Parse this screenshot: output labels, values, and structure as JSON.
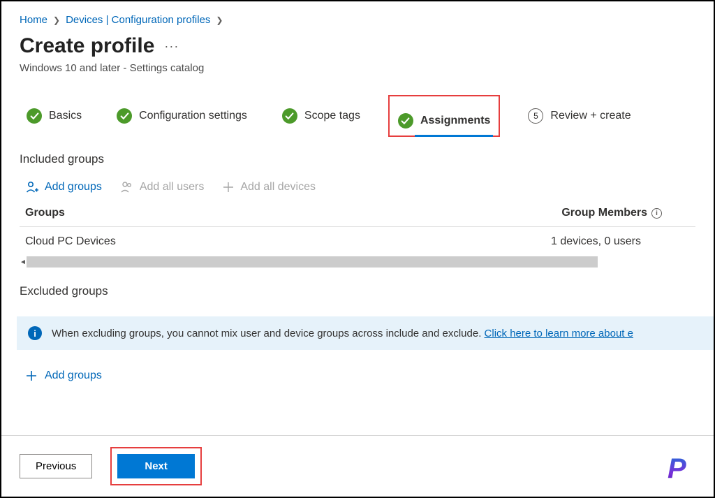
{
  "breadcrumb": {
    "home": "Home",
    "devices": "Devices | Configuration profiles"
  },
  "header": {
    "title": "Create profile",
    "subtitle": "Windows 10 and later - Settings catalog"
  },
  "steps": {
    "basics": "Basics",
    "config": "Configuration settings",
    "scope": "Scope tags",
    "assignments": "Assignments",
    "review_num": "5",
    "review": "Review + create"
  },
  "included": {
    "section": "Included groups",
    "add_groups": "Add groups",
    "add_all_users": "Add all users",
    "add_all_devices": "Add all devices",
    "col_groups": "Groups",
    "col_members": "Group Members",
    "row_name": "Cloud PC Devices",
    "row_members": "1 devices, 0 users"
  },
  "excluded": {
    "section": "Excluded groups",
    "banner_text": "When excluding groups, you cannot mix user and device groups across include and exclude. ",
    "banner_link": "Click here to learn more about e",
    "add_groups": "Add groups"
  },
  "footer": {
    "previous": "Previous",
    "next": "Next"
  },
  "logo": "P"
}
